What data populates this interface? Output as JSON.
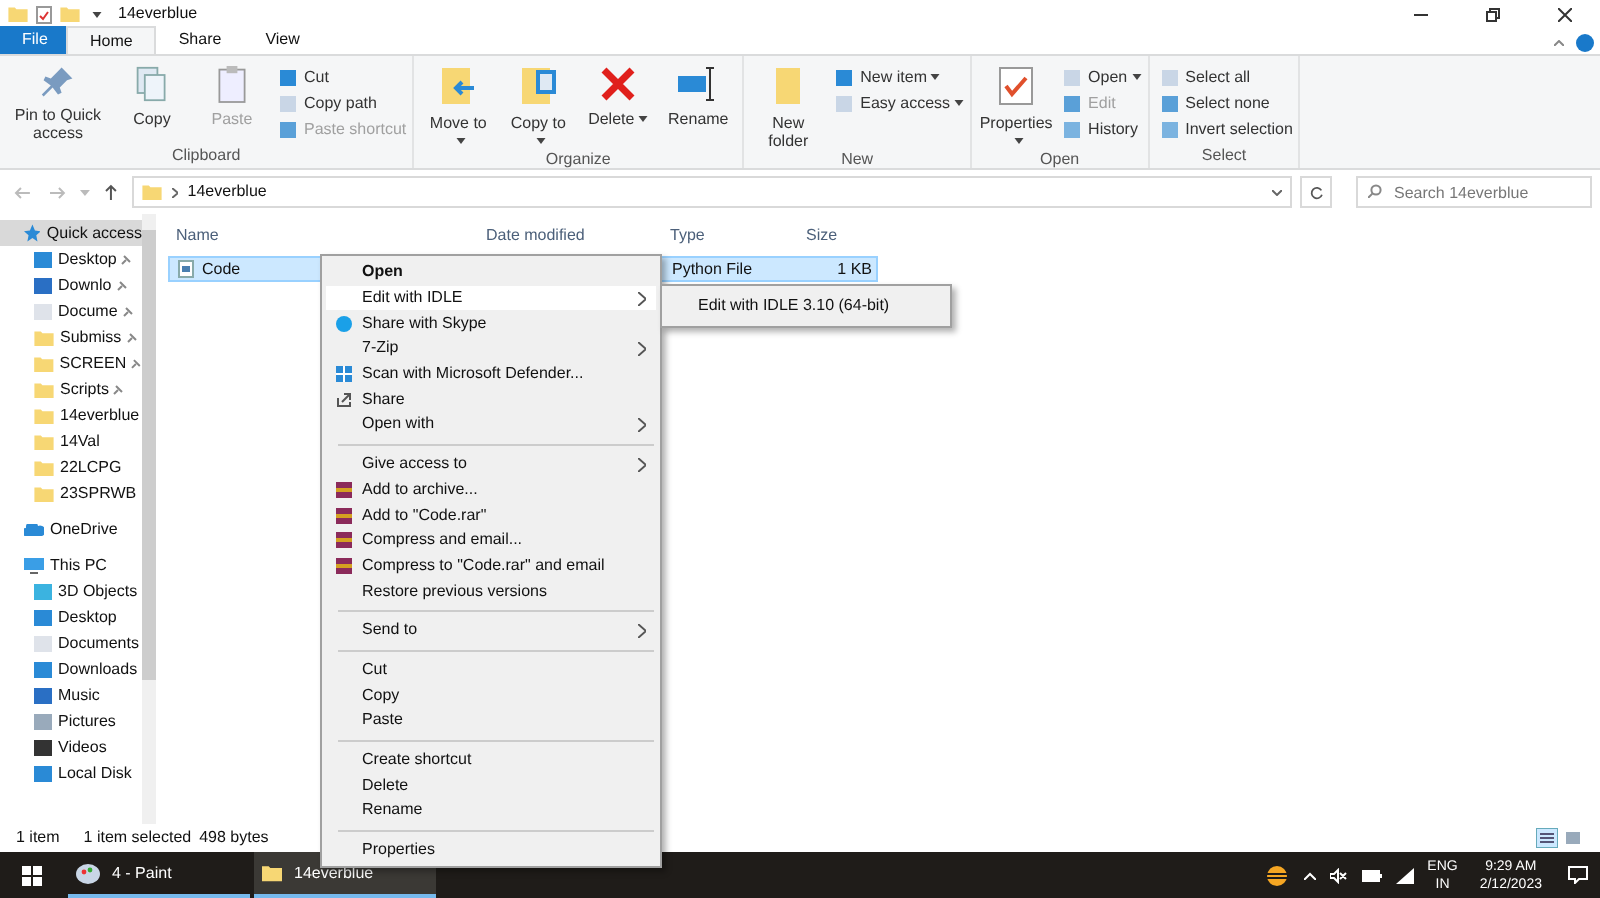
{
  "window": {
    "title": "14everblue"
  },
  "ribbon_tabs": [
    {
      "label": "File",
      "kind": "file",
      "selected": false
    },
    {
      "label": "Home",
      "kind": "tab",
      "selected": true
    },
    {
      "label": "Share",
      "kind": "tab",
      "selected": false
    },
    {
      "label": "View",
      "kind": "tab",
      "selected": false
    }
  ],
  "ribbon_groups": [
    {
      "label": "Clipboard",
      "items": [
        {
          "label": "Pin to Quick access",
          "kind": "large",
          "disabled": false,
          "dropdown": false
        },
        {
          "label": "Copy",
          "kind": "large",
          "disabled": false,
          "dropdown": false
        },
        {
          "label": "Paste",
          "kind": "large",
          "disabled": true,
          "dropdown": false
        },
        {
          "label": "Cut",
          "kind": "small",
          "disabled": false,
          "dropdown": false
        },
        {
          "label": "Copy path",
          "kind": "small",
          "disabled": false,
          "dropdown": false
        },
        {
          "label": "Paste shortcut",
          "kind": "small",
          "disabled": true,
          "dropdown": false
        }
      ]
    },
    {
      "label": "Organize",
      "items": [
        {
          "label": "Move to",
          "kind": "large",
          "disabled": false,
          "dropdown": true
        },
        {
          "label": "Copy to",
          "kind": "large",
          "disabled": false,
          "dropdown": true
        },
        {
          "label": "Delete",
          "kind": "large",
          "disabled": false,
          "dropdown": true
        },
        {
          "label": "Rename",
          "kind": "large",
          "disabled": false,
          "dropdown": false
        }
      ]
    },
    {
      "label": "New",
      "items": [
        {
          "label": "New folder",
          "kind": "large",
          "disabled": false,
          "dropdown": false
        },
        {
          "label": "New item",
          "kind": "small",
          "disabled": false,
          "dropdown": true
        },
        {
          "label": "Easy access",
          "kind": "small",
          "disabled": false,
          "dropdown": true
        }
      ]
    },
    {
      "label": "Open",
      "items": [
        {
          "label": "Properties",
          "kind": "large",
          "disabled": false,
          "dropdown": true
        },
        {
          "label": "Open",
          "kind": "small",
          "disabled": false,
          "dropdown": true
        },
        {
          "label": "Edit",
          "kind": "small",
          "disabled": true,
          "dropdown": false
        },
        {
          "label": "History",
          "kind": "small",
          "disabled": false,
          "dropdown": false
        }
      ]
    },
    {
      "label": "Select",
      "items": [
        {
          "label": "Select all",
          "kind": "small",
          "disabled": false,
          "dropdown": false
        },
        {
          "label": "Select none",
          "kind": "small",
          "disabled": false,
          "dropdown": false
        },
        {
          "label": "Invert selection",
          "kind": "small",
          "disabled": false,
          "dropdown": false
        }
      ]
    }
  ],
  "address_bar": {
    "path": "14everblue"
  },
  "search": {
    "placeholder": "Search 14everblue"
  },
  "sidebar": {
    "items": [
      {
        "label": "Quick access",
        "selected": true,
        "children": [
          {
            "label": "Desktop",
            "pinned": true
          },
          {
            "label": "Downlo",
            "pinned": true
          },
          {
            "label": "Docume",
            "pinned": true
          },
          {
            "label": "Submiss",
            "pinned": true
          },
          {
            "label": "SCREEN",
            "pinned": true
          },
          {
            "label": "Scripts",
            "pinned": true
          },
          {
            "label": "14everblue",
            "pinned": false
          },
          {
            "label": "14Val",
            "pinned": false
          },
          {
            "label": "22LCPG",
            "pinned": false
          },
          {
            "label": "23SPRWB",
            "pinned": false
          }
        ]
      },
      {
        "label": "OneDrive",
        "selected": false
      },
      {
        "label": "This PC",
        "selected": false,
        "children": [
          {
            "label": "3D Objects",
            "pinned": false
          },
          {
            "label": "Desktop",
            "pinned": false
          },
          {
            "label": "Documents",
            "pinned": false
          },
          {
            "label": "Downloads",
            "pinned": false
          },
          {
            "label": "Music",
            "pinned": false
          },
          {
            "label": "Pictures",
            "pinned": false
          },
          {
            "label": "Videos",
            "pinned": false
          },
          {
            "label": "Local Disk",
            "pinned": false
          }
        ]
      }
    ]
  },
  "table": {
    "columns": [
      "Name",
      "Date modified",
      "Type",
      "Size"
    ],
    "rows": [
      {
        "name": "Code",
        "type": "Python File",
        "size": "1 KB",
        "selected": true
      }
    ]
  },
  "context_menu": {
    "items": [
      {
        "kind": "item",
        "label": "Open",
        "bold": true,
        "selected": false
      },
      {
        "kind": "submenu",
        "label": "Edit with IDLE",
        "bold": false,
        "selected": true
      },
      {
        "kind": "item",
        "label": "Share with Skype",
        "bold": false,
        "selected": false
      },
      {
        "kind": "submenu",
        "label": "7-Zip",
        "bold": false,
        "selected": false
      },
      {
        "kind": "item",
        "label": "Scan with Microsoft Defender...",
        "bold": false,
        "selected": false
      },
      {
        "kind": "item",
        "label": "Share",
        "bold": false,
        "selected": false
      },
      {
        "kind": "submenu",
        "label": "Open with",
        "bold": false,
        "selected": false
      },
      {
        "kind": "separator"
      },
      {
        "kind": "submenu",
        "label": "Give access to",
        "bold": false,
        "selected": false
      },
      {
        "kind": "item",
        "label": "Add to archive...",
        "bold": false,
        "selected": false
      },
      {
        "kind": "item",
        "label": "Add to \"Code.rar\"",
        "bold": false,
        "selected": false
      },
      {
        "kind": "item",
        "label": "Compress and email...",
        "bold": false,
        "selected": false
      },
      {
        "kind": "item",
        "label": "Compress to \"Code.rar\" and email",
        "bold": false,
        "selected": false
      },
      {
        "kind": "item",
        "label": "Restore previous versions",
        "bold": false,
        "selected": false
      },
      {
        "kind": "separator"
      },
      {
        "kind": "submenu",
        "label": "Send to",
        "bold": false,
        "selected": false
      },
      {
        "kind": "separator"
      },
      {
        "kind": "item",
        "label": "Cut",
        "bold": false,
        "selected": false
      },
      {
        "kind": "item",
        "label": "Copy",
        "bold": false,
        "selected": false
      },
      {
        "kind": "item",
        "label": "Paste",
        "bold": false,
        "selected": false
      },
      {
        "kind": "separator"
      },
      {
        "kind": "item",
        "label": "Create shortcut",
        "bold": false,
        "selected": false
      },
      {
        "kind": "item",
        "label": "Delete",
        "bold": false,
        "selected": false
      },
      {
        "kind": "item",
        "label": "Rename",
        "bold": false,
        "selected": false
      },
      {
        "kind": "separator"
      },
      {
        "kind": "item",
        "label": "Properties",
        "bold": false,
        "selected": false
      }
    ],
    "submenu": {
      "items": [
        "Edit with IDLE 3.10 (64-bit)"
      ]
    }
  },
  "status_bar": {
    "count": "1 item",
    "selection": "1 item selected",
    "size": "498 bytes"
  },
  "taskbar": {
    "apps": [
      {
        "label": "4 - Paint",
        "selected": false
      },
      {
        "label": "14everblue",
        "selected": true
      }
    ],
    "tray": {
      "language": "ENG",
      "region": "IN",
      "time": "9:29 AM",
      "date": "2/12/2023"
    }
  }
}
